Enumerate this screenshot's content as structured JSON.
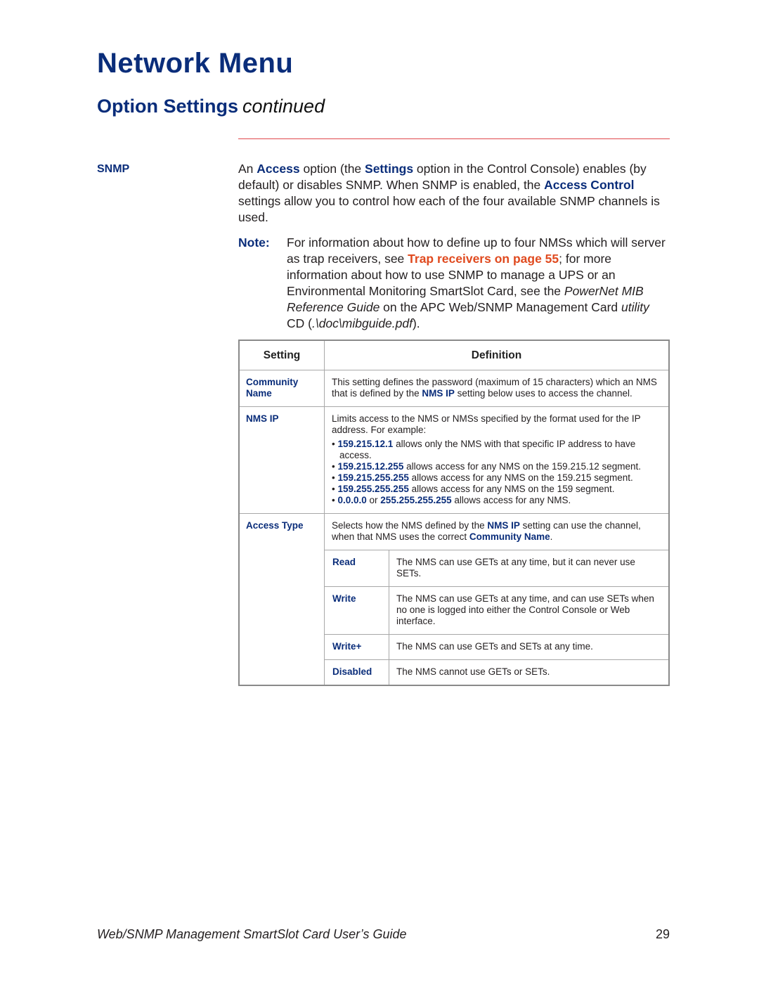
{
  "header": {
    "title": "Network Menu",
    "section": "Option Settings",
    "section_suffix": "continued"
  },
  "snmp": {
    "label": "SNMP",
    "paragraph": [
      {
        "t": "An "
      },
      {
        "b": "Access"
      },
      {
        "t": " option (the "
      },
      {
        "b": "Settings"
      },
      {
        "t": " option in the Control Console) enables (by default) or disables SNMP. When SNMP is enabled, the "
      },
      {
        "b": "Access Control"
      },
      {
        "t": " settings allow you to control how each of the four available SNMP channels is used."
      }
    ]
  },
  "note": {
    "label": "Note:",
    "text_1": "For information about how to define up to four NMSs which will server as trap receivers, see ",
    "link": "Trap receivers on page 55",
    "text_2": "; for more information about how to use SNMP to manage a UPS or an Environmental Monitoring SmartSlot Card, see the ",
    "italic_1": "PowerNet MIB Reference Guide",
    "text_3": " on the APC Web/SNMP Management Card ",
    "italic_2": "utility",
    "text_4": " CD (",
    "italic_3": ".\\doc\\mibguide.pdf",
    "text_5": ")."
  },
  "table": {
    "headers": [
      "Setting",
      "Definition"
    ],
    "community": {
      "name": "Community Name",
      "def_1": "This setting defines the password (maximum of 15 characters) which an NMS that is defined by the ",
      "def_ref": "NMS IP",
      "def_2": " setting below uses to access the channel."
    },
    "nms_ip": {
      "name": "NMS IP",
      "intro": "Limits access to the NMS or NMSs specified by the format used for the IP address. For example:",
      "bullets": [
        {
          "ip": "159.215.12.1",
          "text": " allows only the NMS with that specific IP address to have access."
        },
        {
          "ip": "159.215.12.255",
          "text": " allows access for any NMS on the 159.215.12 segment."
        },
        {
          "ip": "159.215.255.255",
          "text": " allows access for any NMS on the 159.215 segment."
        },
        {
          "ip": "159.255.255.255",
          "text": " allows access for any NMS on the 159 segment."
        },
        {
          "ip": "0.0.0.0",
          "mid": " or ",
          "ip2": "255.255.255.255",
          "text": " allows access for any NMS."
        }
      ]
    },
    "access_type": {
      "name": "Access Type",
      "def_1": "Selects how the NMS defined by the ",
      "def_ref1": "NMS IP",
      "def_2": " setting can use the channel, when that NMS uses the correct ",
      "def_ref2": "Community Name",
      "def_3": ".",
      "options": [
        {
          "name": "Read",
          "def": "The NMS can use GETs at any time, but it can never use SETs."
        },
        {
          "name": "Write",
          "def": "The NMS can use GETs at any time, and can use SETs when no one is logged into either the Control Console or Web interface."
        },
        {
          "name": "Write+",
          "def": "The NMS can use GETs and SETs at any time."
        },
        {
          "name": "Disabled",
          "def": "The NMS cannot use GETs or SETs."
        }
      ]
    }
  },
  "footer": {
    "title": "Web/SNMP Management SmartSlot Card User’s Guide",
    "page": "29"
  }
}
